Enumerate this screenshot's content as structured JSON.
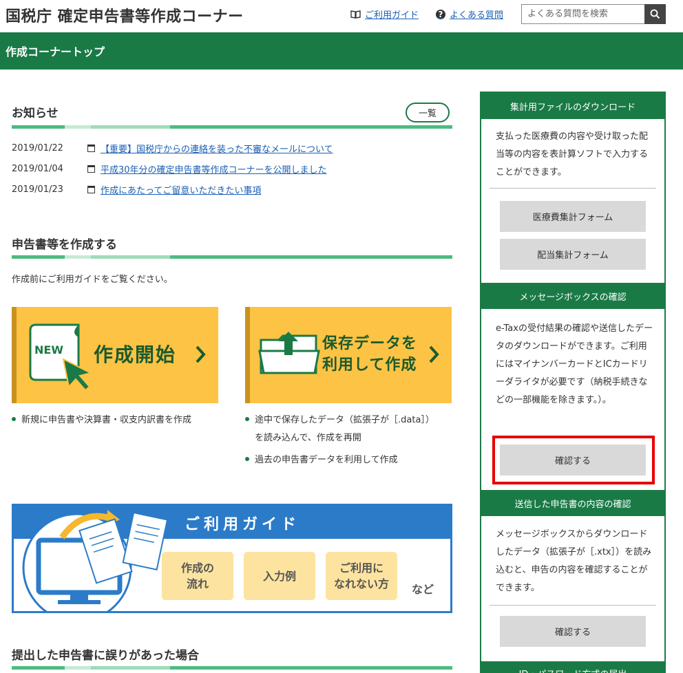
{
  "header": {
    "site_title": "国税庁 確定申告書等作成コーナー",
    "guide_link": "ご利用ガイド",
    "faq_link": "よくある質問",
    "search_placeholder": "よくある質問を検索"
  },
  "topbar": {
    "title": "作成コーナートップ"
  },
  "news": {
    "title": "お知らせ",
    "list_button": "一覧",
    "items": [
      {
        "date": "2019/01/22",
        "text": "【重要】国税庁からの連絡を装った不審なメールについて"
      },
      {
        "date": "2019/01/04",
        "text": "平成30年分の確定申告書等作成コーナーを公開しました"
      },
      {
        "date": "2019/01/23",
        "text": "作成にあたってご留意いただきたい事項"
      }
    ]
  },
  "create": {
    "title": "申告書等を作成する",
    "intro": "作成前にご利用ガイドをご覧ください。",
    "start_card": {
      "badge": "NEW",
      "label": "作成開始"
    },
    "load_card": {
      "label_line1": "保存データを",
      "label_line2": "利用して作成"
    },
    "start_bullets": [
      "新規に申告書や決算書・収支内訳書を作成"
    ],
    "load_bullets": [
      "途中で保存したデータ（拡張子が［.data］）",
      "を読み込んで、作成を再開",
      "過去の申告書データを利用して作成"
    ]
  },
  "guide_banner": {
    "title": "ご利用ガイド",
    "pills": [
      "作成の\n流れ",
      "入力例",
      "ご利用に\nなれない方"
    ],
    "suffix": "など"
  },
  "error_section": {
    "title": "提出した申告書に誤りがあった場合"
  },
  "sidebar": {
    "download": {
      "header": "集計用ファイルのダウンロード",
      "text": "支払った医療費の内容や受け取った配当等の内容を表計算ソフトで入力することができます。",
      "buttons": [
        "医療費集計フォーム",
        "配当集計フォーム"
      ]
    },
    "messagebox": {
      "header": "メッセージボックスの確認",
      "text": "e-Taxの受付結果の確認や送信したデータのダウンロードができます。ご利用にはマイナンバーカードとICカードリーダライタが必要です（納税手続きなどの一部機能を除きます。）。",
      "button": "確認する"
    },
    "sent": {
      "header": "送信した申告書の内容の確認",
      "text": "メッセージボックスからダウンロードしたデータ（拡張子が［.xtx］）を読み込むと、申告の内容を確認することができます。",
      "button": "確認する"
    },
    "next_header": "ID・パスワード方式の届出"
  },
  "colors": {
    "brand_green": "#1a7a46",
    "card_yellow": "#fdc344",
    "guide_blue": "#2b7bc9",
    "highlight_red": "#e60000"
  }
}
